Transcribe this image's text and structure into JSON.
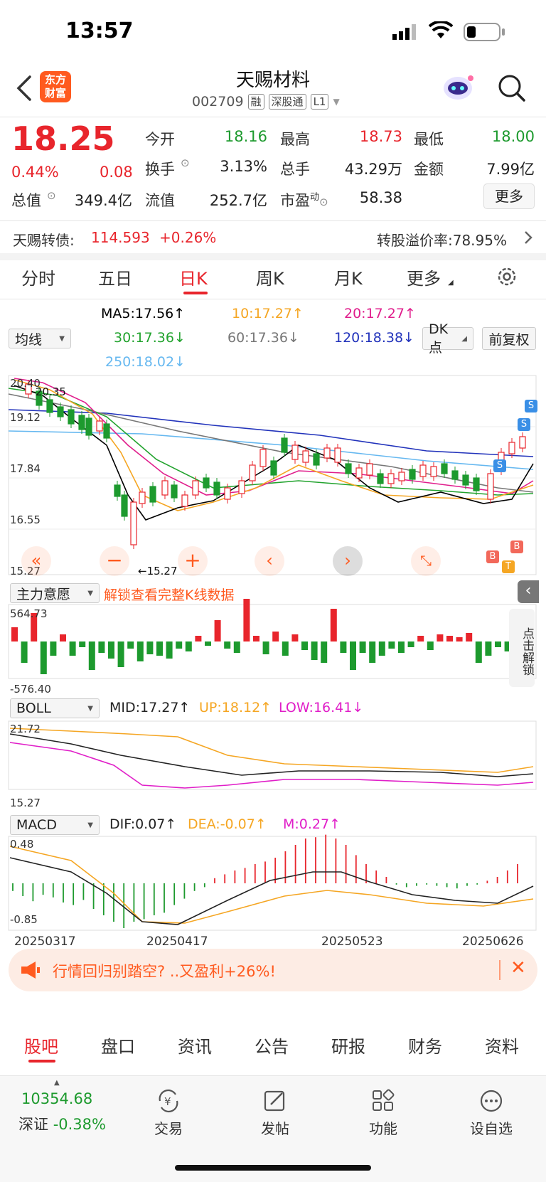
{
  "status_bar": {
    "time": "13:57"
  },
  "header": {
    "logo_text_1": "东方",
    "logo_text_2": "财富",
    "title": "天赐材料",
    "code": "002709",
    "tags": [
      "融",
      "深股通",
      "L1"
    ]
  },
  "quote": {
    "price": "18.25",
    "change_pct": "0.44%",
    "change": "0.08",
    "open_label": "今开",
    "open": "18.16",
    "high_label": "最高",
    "high": "18.73",
    "low_label": "最低",
    "low": "18.00",
    "turnover_label": "换手",
    "turnover": "3.13%",
    "volume_label": "总手",
    "volume": "43.29万",
    "amount_label": "金额",
    "amount": "7.99亿",
    "mktcap_label": "总值",
    "mktcap": "349.4亿",
    "float_label": "流值",
    "float": "252.7亿",
    "pe_label": "市盈",
    "pe_sup": "动",
    "pe": "58.38",
    "more": "更多"
  },
  "bond": {
    "name": "天赐转债:",
    "price": "114.593",
    "change": "+0.26%",
    "premium": "转股溢价率:78.95%"
  },
  "period_tabs": [
    "分时",
    "五日",
    "日K",
    "周K",
    "月K",
    "更多"
  ],
  "period_active": 2,
  "ma": {
    "selector": "均线",
    "ma5": "MA5:17.56↑",
    "ma10": "10:17.27↑",
    "ma20": "20:17.27↑",
    "ma30": "30:17.36↓",
    "ma60": "60:17.36↓",
    "ma120": "120:18.38↓",
    "ma250": "250:18.02↓",
    "dk_button": "DK点",
    "adjust_button": "前复权"
  },
  "kline": {
    "y_labels": [
      "20.40",
      "19.12",
      "17.84",
      "16.55",
      "15.27"
    ],
    "high_mark": "20.35",
    "low_mark": "←15.27",
    "signals": [
      "S",
      "S",
      "S",
      "B",
      "B",
      "T"
    ]
  },
  "main_force": {
    "selector": "主力意愿",
    "unlock_text": "解锁查看完整K线数据",
    "y_max": "564.73",
    "y_min": "-576.40",
    "side_button": "点击解锁"
  },
  "boll": {
    "selector": "BOLL",
    "mid": "MID:17.27↑",
    "up": "UP:18.12↑",
    "low": "LOW:16.41↓",
    "y_max": "21.72",
    "y_min": "15.27"
  },
  "macd": {
    "selector": "MACD",
    "dif": "DIF:0.07↑",
    "dea": "DEA:-0.07↑",
    "m": "M:0.27↑",
    "y_max": "0.48",
    "y_min": "-0.85"
  },
  "dates": [
    "20250317",
    "20250417",
    "20250523",
    "20250626"
  ],
  "ad_banner": {
    "text": "行情回归别踏空? ..又盈利+26%!"
  },
  "bottom_tabs": [
    "股吧",
    "盘口",
    "资讯",
    "公告",
    "研报",
    "财务",
    "资料"
  ],
  "bottom_active": 0,
  "index": {
    "value": "10354.68",
    "name": "深证",
    "change": "-0.38%"
  },
  "nav": [
    {
      "label": "交易",
      "icon": "yen-exchange-icon"
    },
    {
      "label": "发帖",
      "icon": "edit-post-icon"
    },
    {
      "label": "功能",
      "icon": "grid-apps-icon"
    },
    {
      "label": "设自选",
      "icon": "more-dots-icon"
    }
  ],
  "colors": {
    "up": "#e8252c",
    "down": "#1d9a2e",
    "accent": "#ff5a1f",
    "ma5": "#000000",
    "ma10": "#f5a623",
    "ma20": "#e01e8c",
    "ma30": "#22a32e",
    "ma60": "#777777",
    "ma120": "#2233bb",
    "ma250": "#66b8f0"
  }
}
